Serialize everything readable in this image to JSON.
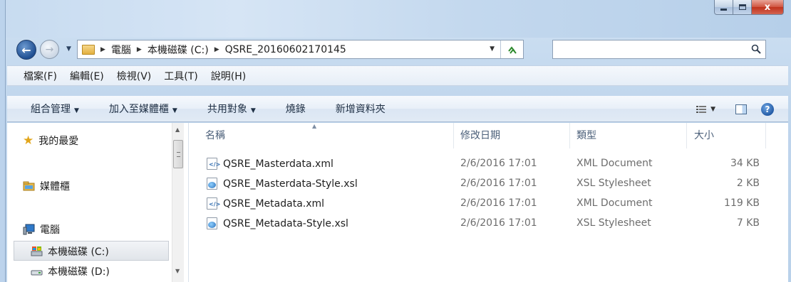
{
  "window": {
    "close_glyph": "x"
  },
  "address": {
    "crumbs": [
      "電腦",
      "本機磁碟 (C:)",
      "QSRE_20160602170145"
    ]
  },
  "menu": {
    "items": [
      "檔案(F)",
      "編輯(E)",
      "檢視(V)",
      "工具(T)",
      "說明(H)"
    ]
  },
  "commands": {
    "organize": "組合管理",
    "include_in_library": "加入至媒體櫃",
    "share_with": "共用對象",
    "burn": "燒錄",
    "new_folder": "新增資料夾"
  },
  "nav_pane": {
    "favorites": "我的最愛",
    "libraries": "媒體櫃",
    "computer": "電腦",
    "drive_c": "本機磁碟 (C:)",
    "drive_d": "本機磁碟 (D:)"
  },
  "columns": {
    "name": "名稱",
    "date": "修改日期",
    "type": "類型",
    "size": "大小"
  },
  "files": [
    {
      "name": "QSRE_Masterdata.xml",
      "date": "2/6/2016 17:01",
      "type": "XML Document",
      "size": "34 KB",
      "icon": "xml-file-icon"
    },
    {
      "name": "QSRE_Masterdata-Style.xsl",
      "date": "2/6/2016 17:01",
      "type": "XSL Stylesheet",
      "size": "2 KB",
      "icon": "xsl-file-icon"
    },
    {
      "name": "QSRE_Metadata.xml",
      "date": "2/6/2016 17:01",
      "type": "XML Document",
      "size": "119 KB",
      "icon": "xml-file-icon"
    },
    {
      "name": "QSRE_Metadata-Style.xsl",
      "date": "2/6/2016 17:01",
      "type": "XSL Stylesheet",
      "size": "7 KB",
      "icon": "xsl-file-icon"
    }
  ],
  "colors": {
    "accent": "#1f4f92",
    "frame": "#bfd5ec",
    "close_button": "#c0321c",
    "secondary_text": "#6d6d6d"
  }
}
